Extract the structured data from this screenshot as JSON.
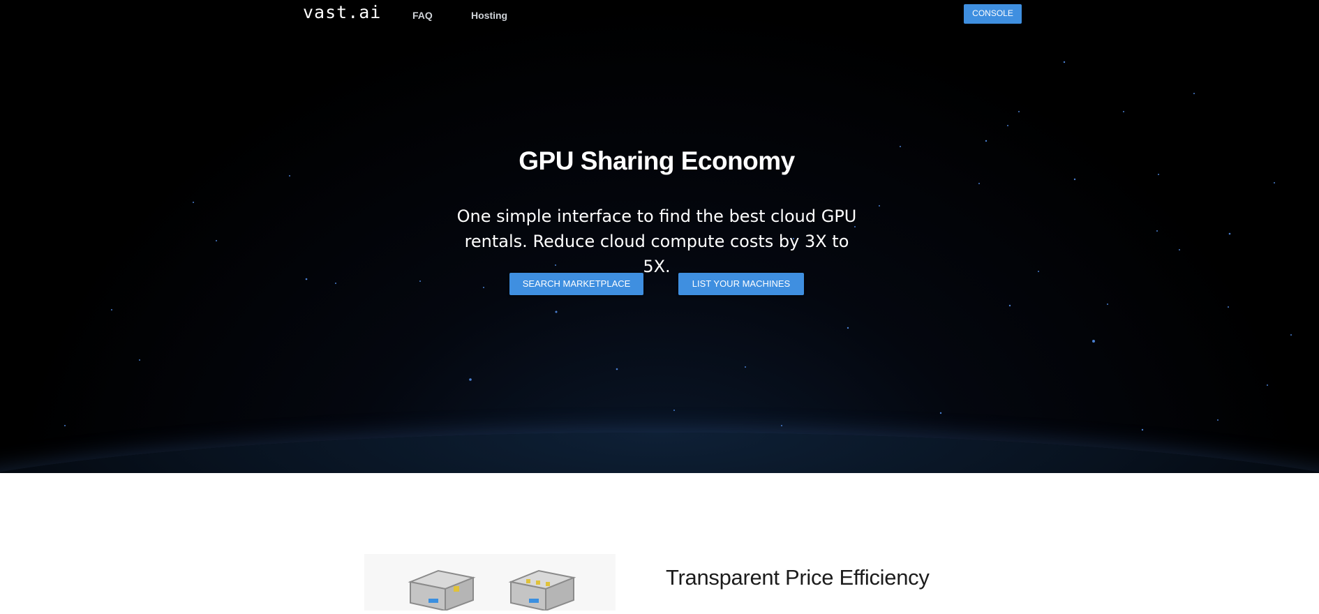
{
  "nav": {
    "logo": "vast.ai",
    "links": [
      "FAQ",
      "Hosting"
    ],
    "console_label": "CONSOLE"
  },
  "hero": {
    "title": "GPU Sharing Economy",
    "subtitle": "One simple interface to find the best cloud GPU rentals. Reduce cloud compute costs by 3X to 5X.",
    "buttons": [
      "SEARCH MARKETPLACE",
      "LIST YOUR MACHINES"
    ]
  },
  "feature": {
    "title": "Transparent Price Efficiency",
    "image_icon": "gpu-rig-illustration"
  },
  "colors": {
    "accent": "#3f8fe0",
    "hero_bg": "#000000",
    "text_light": "#ffffff",
    "text_dark": "#1c1c1c"
  }
}
